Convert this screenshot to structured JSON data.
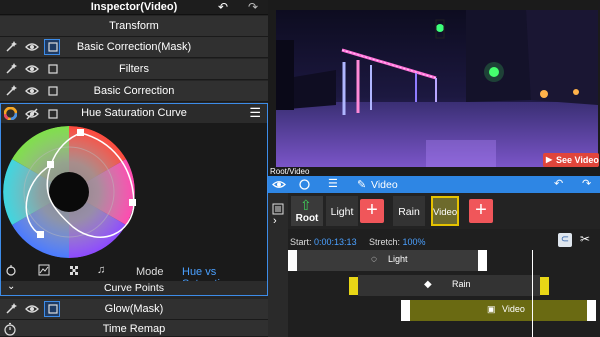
{
  "inspector": {
    "title": "Inspector(Video)",
    "undo_icon": "undo-icon",
    "redo_icon": "redo-icon",
    "rows": {
      "transform": "Transform",
      "basic_correction_mask": "Basic Correction(Mask)",
      "filters": "Filters",
      "basic_correction": "Basic Correction",
      "glow_mask": "Glow(Mask)",
      "time_remap": "Time Remap"
    },
    "hue_saturation": {
      "title": "Hue Saturation Curve",
      "mode_label": "Mode",
      "mode_value": "Hue vs Saturation",
      "curve_points_label": "Curve Points"
    }
  },
  "preview": {
    "see_video_label": "See Video"
  },
  "path": "Root/Video",
  "toolbar": {
    "video_label": "Video"
  },
  "layers": {
    "root": "Root",
    "light": "Light",
    "rain": "Rain",
    "video": "Video"
  },
  "timeline": {
    "start_label": "Start:",
    "start_value": "0:00:13:13",
    "stretch_label": "Stretch:",
    "stretch_value": "100%",
    "tracks": {
      "light": "Light",
      "rain": "Rain",
      "video": "Video"
    }
  },
  "colors": {
    "accent": "#2e86e4",
    "add_button": "#f0565a",
    "selected_clip": "#6d6a2c",
    "clip_handle": "#e8d616",
    "see_video": "#e0453b"
  }
}
